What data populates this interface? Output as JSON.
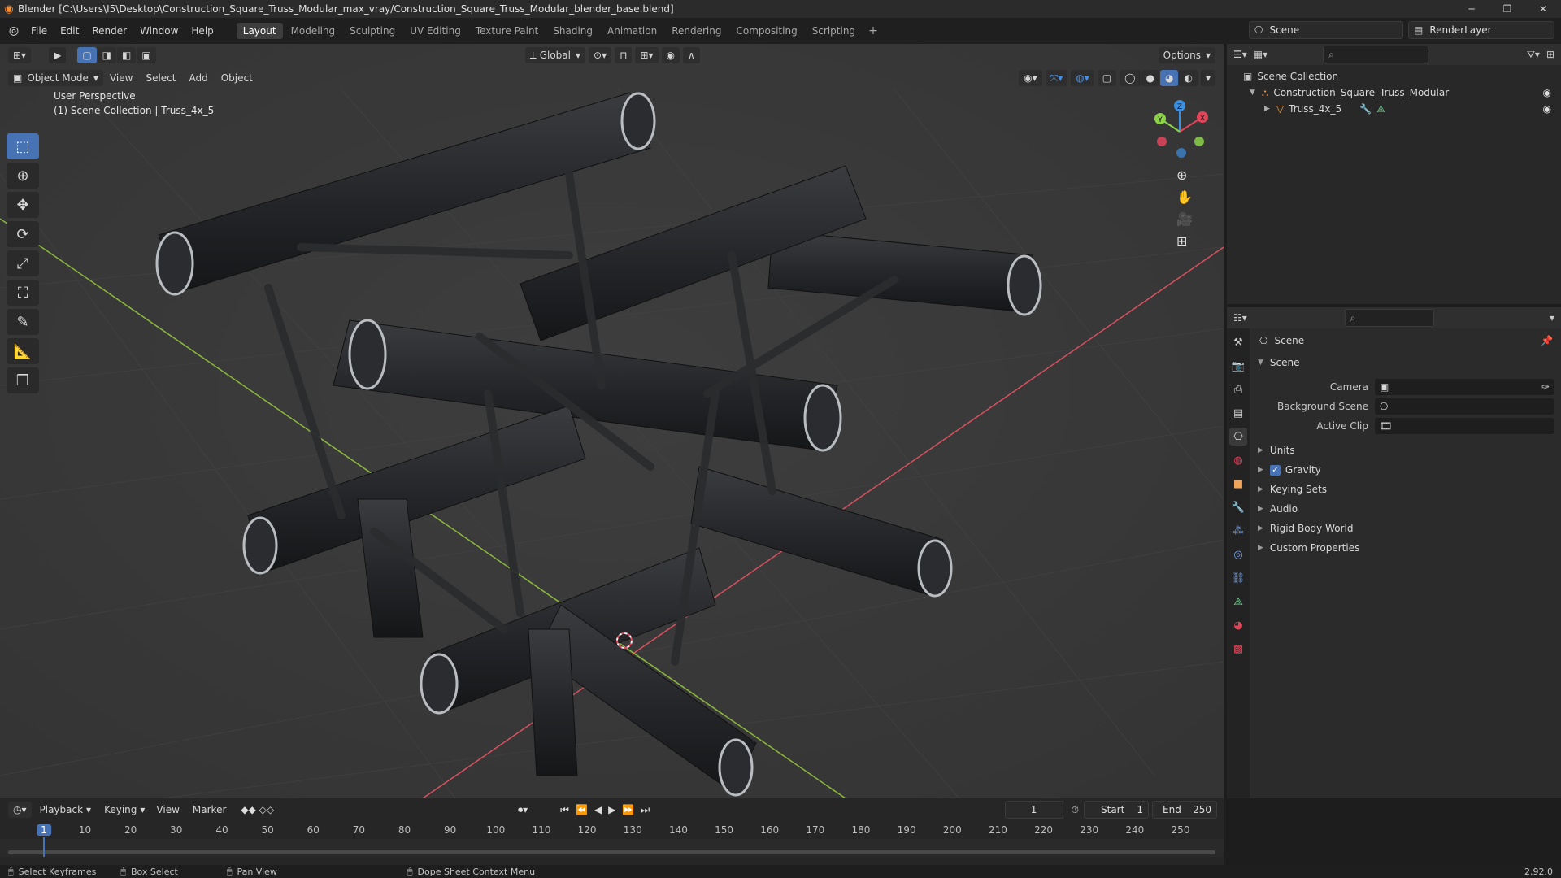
{
  "window": {
    "title": "Blender [C:\\Users\\I5\\Desktop\\Construction_Square_Truss_Modular_max_vray/Construction_Square_Truss_Modular_blender_base.blend]",
    "minimize": "─",
    "maximize": "❐",
    "close": "✕"
  },
  "menubar": {
    "menus": [
      "File",
      "Edit",
      "Render",
      "Window",
      "Help"
    ],
    "workspaces": [
      "Layout",
      "Modeling",
      "Sculpting",
      "UV Editing",
      "Texture Paint",
      "Shading",
      "Animation",
      "Rendering",
      "Compositing",
      "Scripting"
    ],
    "active_workspace": "Layout",
    "scene_name": "Scene",
    "view_layer": "RenderLayer"
  },
  "viewport": {
    "mode": "Object Mode",
    "menus": [
      "View",
      "Select",
      "Add",
      "Object"
    ],
    "transform_orientation": "Global",
    "options_label": "Options",
    "perspective_label": "User Perspective",
    "collection_label": "(1) Scene Collection | Truss_4x_5",
    "gizmo": {
      "x": "X",
      "y": "Y",
      "z": "Z"
    }
  },
  "outliner": {
    "root": "Scene Collection",
    "items": [
      {
        "label": "Construction_Square_Truss_Modular",
        "depth": 1
      },
      {
        "label": "Truss_4x_5",
        "depth": 2
      }
    ]
  },
  "properties": {
    "context": "Scene",
    "panel_title": "Scene",
    "fields": [
      {
        "label": "Camera",
        "value": ""
      },
      {
        "label": "Background Scene",
        "value": ""
      },
      {
        "label": "Active Clip",
        "value": ""
      }
    ],
    "panels": [
      "Units",
      "Gravity",
      "Keying Sets",
      "Audio",
      "Rigid Body World",
      "Custom Properties"
    ],
    "gravity_checked": true
  },
  "timeline": {
    "menus": [
      "Playback",
      "Keying",
      "View",
      "Marker"
    ],
    "current_frame": "1",
    "start_label": "Start",
    "start": "1",
    "end_label": "End",
    "end": "250",
    "ticks": [
      "1",
      "10",
      "20",
      "30",
      "40",
      "50",
      "60",
      "70",
      "80",
      "90",
      "100",
      "110",
      "120",
      "130",
      "140",
      "150",
      "160",
      "170",
      "180",
      "190",
      "200",
      "210",
      "220",
      "230",
      "240",
      "250"
    ]
  },
  "statusbar": {
    "items": [
      "Select Keyframes",
      "Box Select",
      "Pan View",
      "Dope Sheet Context Menu"
    ],
    "version": "2.92.0"
  },
  "colors": {
    "accent": "#4772b3",
    "x_axis": "#e0455a",
    "y_axis": "#8bd14a",
    "z_axis": "#3d8fe0"
  }
}
